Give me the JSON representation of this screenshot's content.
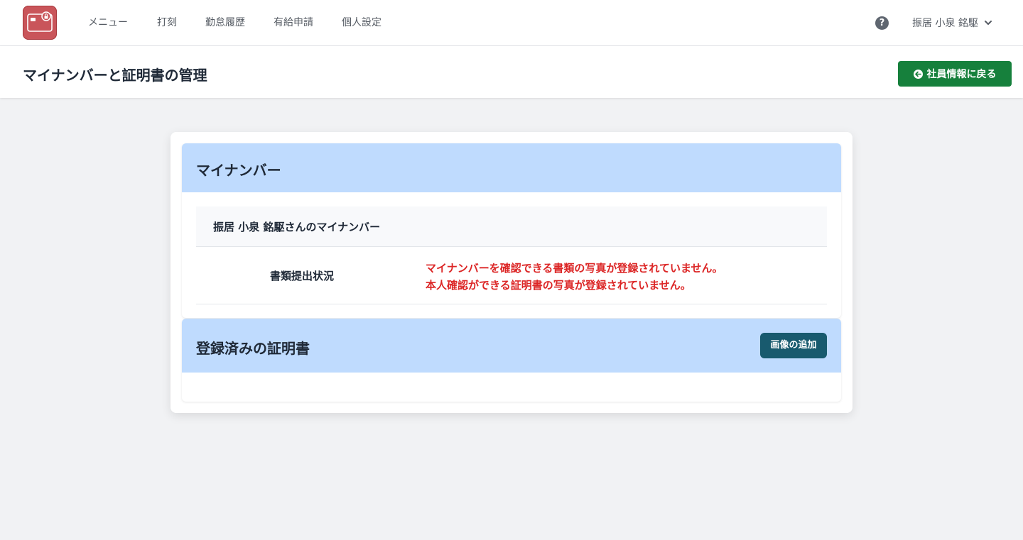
{
  "nav": {
    "items": [
      {
        "label": "メニュー"
      },
      {
        "label": "打刻"
      },
      {
        "label": "勤怠履歴"
      },
      {
        "label": "有給申請"
      },
      {
        "label": "個人設定"
      }
    ],
    "user_name": "振居 小泉 銘駆",
    "help_icon": "question-circle-icon"
  },
  "page": {
    "title": "マイナンバーと証明書の管理",
    "back_button_label": "社員情報に戻る"
  },
  "mynumber": {
    "title": "マイナンバー",
    "owner_heading": "振居 小泉 銘駆さんのマイナンバー",
    "status_label": "書類提出状況",
    "status_messages": [
      "マイナンバーを確認できる書類の写真が登録されていません。",
      "本人確認ができる証明書の写真が登録されていません。"
    ]
  },
  "certificates": {
    "title": "登録済みの証明書",
    "add_button_label": "画像の追加"
  },
  "colors": {
    "accent_green": "#16803c",
    "panel_header_blue": "#bfdbfe",
    "error_red": "#dc2626",
    "teal_button": "#185a6e",
    "logo_red": "#c9555a"
  }
}
